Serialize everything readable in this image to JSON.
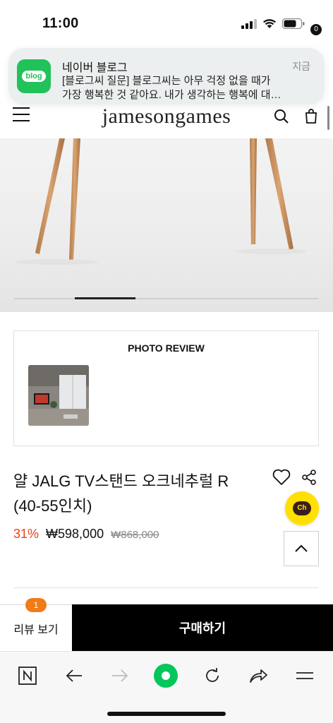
{
  "status_bar": {
    "time": "11:00",
    "icons": [
      "signal-icon",
      "wifi-icon",
      "battery-icon"
    ]
  },
  "notification": {
    "app_icon_text": "blog",
    "app_name": "네이버 블로그",
    "time": "지금",
    "body": "[블로그씨 질문] 블로그씨는 아무 걱정 없을 때가\n가장 행복한 것 같아요. 내가 생각하는 행복에 대…",
    "accent": "#21c25a"
  },
  "header": {
    "logo": "jamesongames",
    "cart_count": "0"
  },
  "photo_review": {
    "title": "PHOTO REVIEW"
  },
  "product": {
    "name": "얄 JALG TV스탠드 오크네추럴 R\n(40-55인치)",
    "discount": "31%",
    "price": "₩598,000",
    "original_price": "₩868,000",
    "discount_color": "#e8431a"
  },
  "kakao": {
    "label": "Ch",
    "color": "#ffe000"
  },
  "action_bar": {
    "review_label": "리뷰 보기",
    "review_count": "1",
    "buy_label": "구매하기"
  },
  "browser_bar": {
    "icons": [
      "naver-n-icon",
      "back-arrow-icon",
      "forward-arrow-icon",
      "green-home-icon",
      "reload-icon",
      "share-icon",
      "menu-icon"
    ]
  }
}
